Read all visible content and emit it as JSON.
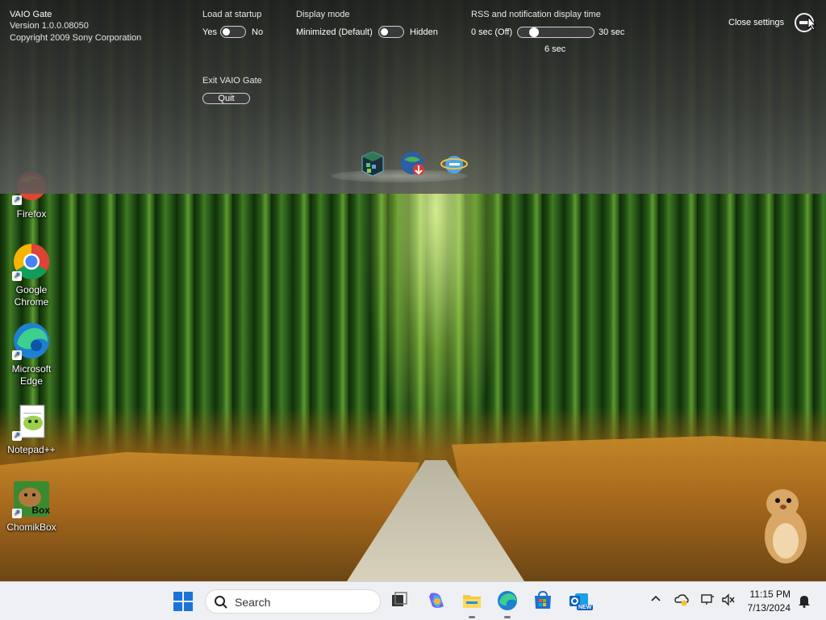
{
  "vaio_gate": {
    "app_name": "VAIO Gate",
    "version": "Version 1.0.0.08050",
    "copyright": "Copyright 2009 Sony Corporation",
    "load_at_startup": {
      "label": "Load at startup",
      "yes": "Yes",
      "no": "No",
      "state": "Yes"
    },
    "display_mode": {
      "label": "Display mode",
      "option_on": "Minimized (Default)",
      "option_off": "Hidden",
      "state": "Minimized (Default)"
    },
    "display_time": {
      "label": "RSS and notification display time",
      "min_label": "0 sec (Off)",
      "max_label": "30 sec",
      "value_label": "6 sec",
      "value": 6,
      "min": 0,
      "max": 30
    },
    "exit": {
      "label": "Exit VAIO Gate",
      "button": "Quit"
    },
    "close_settings": "Close settings",
    "dock_icons": [
      "vaio-cube-icon",
      "globe-download-icon",
      "internet-explorer-icon"
    ]
  },
  "desktop": {
    "icons": [
      {
        "name": "Firefox",
        "icon": "firefox-icon"
      },
      {
        "name": "Google Chrome",
        "icon": "chrome-icon"
      },
      {
        "name": "Microsoft Edge",
        "icon": "edge-icon"
      },
      {
        "name": "Notepad++",
        "icon": "notepad-plus-plus-icon"
      },
      {
        "name": "ChomikBox",
        "icon": "chomikbox-icon",
        "badge": "Box"
      }
    ]
  },
  "taskbar": {
    "search_placeholder": "Search",
    "pinned": [
      "start-icon",
      "task-view-icon",
      "copilot-icon",
      "file-explorer-icon",
      "edge-icon",
      "microsoft-store-icon",
      "outlook-icon"
    ],
    "outlook_badge": "NEW",
    "tray_icons": [
      "chevron-up-icon",
      "onedrive-icon",
      "network-icon",
      "volume-muted-icon",
      "notification-icon"
    ],
    "clock": {
      "time": "11:15 PM",
      "date": "7/13/2024"
    }
  }
}
